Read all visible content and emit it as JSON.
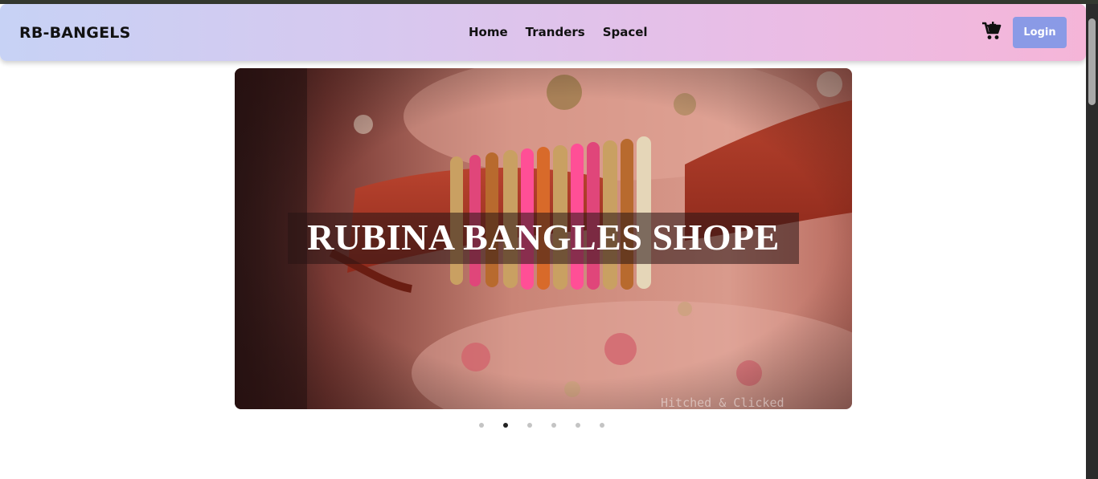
{
  "brand": {
    "name": "RB-BANGELS"
  },
  "nav": {
    "links": [
      {
        "label": "Home"
      },
      {
        "label": "Tranders"
      },
      {
        "label": "Spacel"
      }
    ]
  },
  "header": {
    "cart_icon": "cart-icon",
    "login_label": "Login"
  },
  "carousel": {
    "caption": "RUBINA BANGLES SHOPE",
    "watermark": "Hitched & Clicked",
    "slide_count": 6,
    "active_index": 1
  },
  "colors": {
    "login_bg": "#8a9ae6",
    "nav_gradient_start": "#c7d2f5",
    "nav_gradient_end": "#f5b5d8"
  }
}
